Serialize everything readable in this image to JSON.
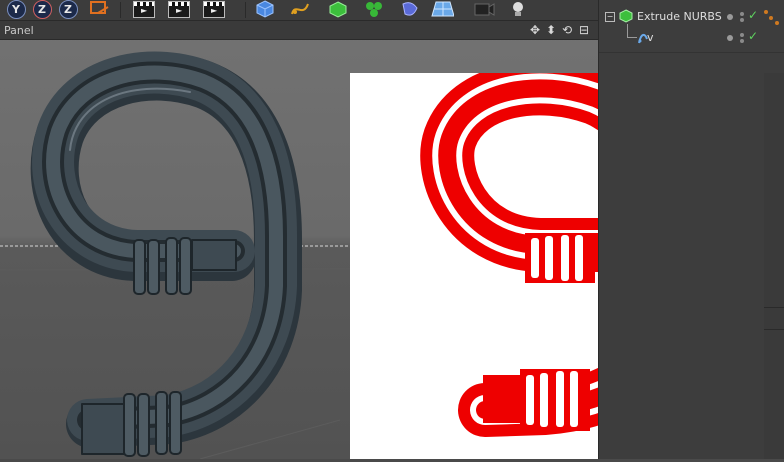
{
  "toolbar": {
    "buttons": [
      {
        "name": "rotate-y-icon",
        "glyph": "Y"
      },
      {
        "name": "rotate-z-icon",
        "glyph": "Z"
      },
      {
        "name": "coordinate-system-icon",
        "glyph": "↘"
      },
      {
        "name": "render-view-icon"
      },
      {
        "name": "render-to-picture-viewer-icon"
      },
      {
        "name": "render-settings-icon"
      },
      {
        "name": "cube-icon"
      },
      {
        "name": "pen-spline-icon"
      },
      {
        "name": "subdivision-surface-icon"
      },
      {
        "name": "cloner-icon"
      },
      {
        "name": "deformer-icon"
      },
      {
        "name": "floor-icon"
      },
      {
        "name": "camera-icon"
      },
      {
        "name": "light-icon"
      }
    ]
  },
  "viewport": {
    "panel_label": "Panel",
    "nav_icons": [
      "move-view-icon",
      "dolly-view-icon",
      "rotate-view-icon",
      "toggle-view-icon"
    ]
  },
  "object_manager": {
    "objects": [
      {
        "name": "Extrude NURBS",
        "icon": "extrude-nurbs-icon",
        "visible": true
      },
      {
        "name": "v",
        "icon": "spline-icon",
        "visible": true
      }
    ]
  },
  "colors": {
    "model_gray": "#3e4a52",
    "reference_red": "#ee0000",
    "check_green": "#5fd35f"
  }
}
